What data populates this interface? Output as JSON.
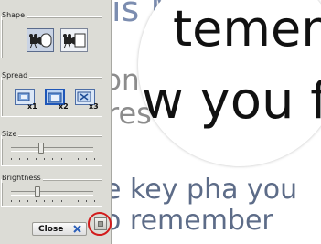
{
  "document": {
    "lines": [
      "is Means",
      "ong",
      "res",
      "e key pha",
      "o remember"
    ],
    "line3_suffix": "you"
  },
  "magnifier": {
    "line1": "temen",
    "line2": "w you fe"
  },
  "panel": {
    "shape": {
      "label": "Shape",
      "options": [
        {
          "icon": "camera-circle-icon",
          "selected": true
        },
        {
          "icon": "camera-rect-icon",
          "selected": false
        }
      ]
    },
    "spread": {
      "label": "Spread",
      "options": [
        {
          "label": "x1",
          "icon": "spread-x1-icon",
          "selected": false
        },
        {
          "label": "x2",
          "icon": "spread-x2-icon",
          "selected": true
        },
        {
          "label": "x3",
          "icon": "spread-x3-icon",
          "selected": false
        }
      ]
    },
    "size": {
      "label": "Size",
      "value": 0.36
    },
    "brightness": {
      "label": "Brightness",
      "value": 0.31
    },
    "close_label": "Close",
    "colors": {
      "panel_bg": "#dcdcd6",
      "highlight": "#d21b1b",
      "doc_text": "#6d7f9d"
    }
  }
}
